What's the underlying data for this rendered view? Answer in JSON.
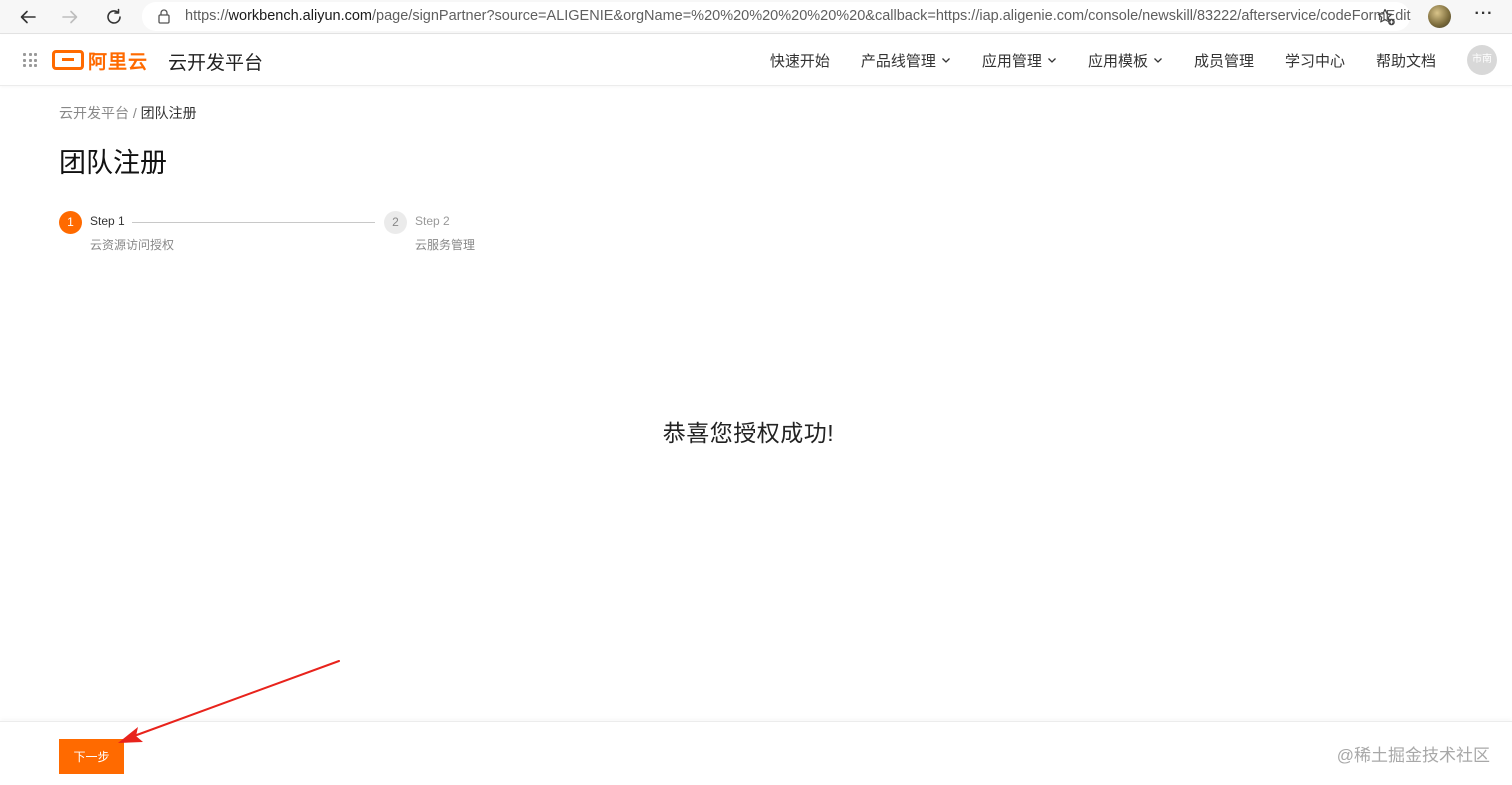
{
  "browser": {
    "url_prefix": "https://",
    "url_host": "workbench.aliyun.com",
    "url_rest": "/page/signPartner?source=ALIGENIE&orgName=%20%20%20%20%20%20&callback=https://iap.aligenie.com/console/newskill/83222/afterservice/codeFormEdit",
    "more_label": "···"
  },
  "header": {
    "logo_text": "阿里云",
    "platform_title": "云开发平台",
    "nav": [
      {
        "label": "快速开始",
        "has_dropdown": false
      },
      {
        "label": "产品线管理",
        "has_dropdown": true
      },
      {
        "label": "应用管理",
        "has_dropdown": true
      },
      {
        "label": "应用模板",
        "has_dropdown": true
      },
      {
        "label": "成员管理",
        "has_dropdown": false
      },
      {
        "label": "学习中心",
        "has_dropdown": false
      },
      {
        "label": "帮助文档",
        "has_dropdown": false
      }
    ],
    "avatar_text": "市南"
  },
  "breadcrumb": {
    "root": "云开发平台",
    "separator": " / ",
    "current": "团队注册"
  },
  "page_title": "团队注册",
  "steps": [
    {
      "number": "1",
      "title": "Step 1",
      "description": "云资源访问授权",
      "status": "active"
    },
    {
      "number": "2",
      "title": "Step 2",
      "description": "云服务管理",
      "status": "pending"
    }
  ],
  "success_message": "恭喜您授权成功!",
  "footer": {
    "next_button": "下一步",
    "watermark": "@稀土掘金技术社区"
  },
  "colors": {
    "accent": "#ff6a00",
    "annotation_arrow": "#e8231c"
  }
}
